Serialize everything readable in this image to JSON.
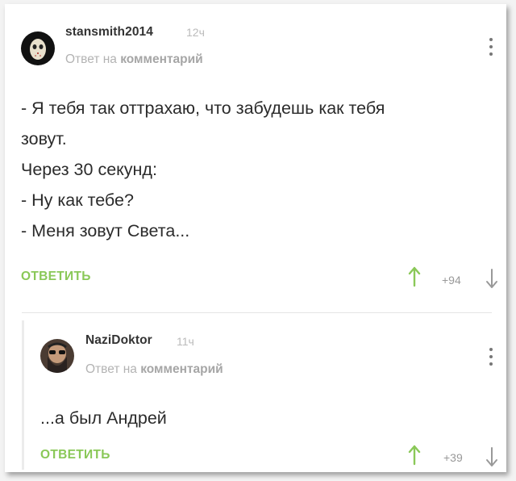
{
  "comments": [
    {
      "username": "stansmith2014",
      "time": "12ч",
      "reply_prefix": "Ответ на",
      "reply_target": "комментарий",
      "lines": [
        "- Я тебя так оттрахаю, что забудешь как тебя",
        "зовут.",
        "Через 30 секунд:",
        "- Ну как тебе?",
        "- Меня зовут Света..."
      ],
      "reply_label": "ОТВЕТИТЬ",
      "score": "+94"
    },
    {
      "username": "NaziDoktor",
      "time": "11ч",
      "reply_prefix": "Ответ на",
      "reply_target": "комментарий",
      "lines": [
        "...а был Андрей"
      ],
      "reply_label": "ОТВЕТИТЬ",
      "score": "+39"
    }
  ],
  "colors": {
    "accent": "#8ac858",
    "text": "#2b2b2b",
    "muted": "#b3b3b3"
  },
  "icons": [
    "avatar-mask",
    "avatar-bearded",
    "kebab-menu-icon",
    "arrow-up-icon",
    "arrow-down-icon"
  ]
}
